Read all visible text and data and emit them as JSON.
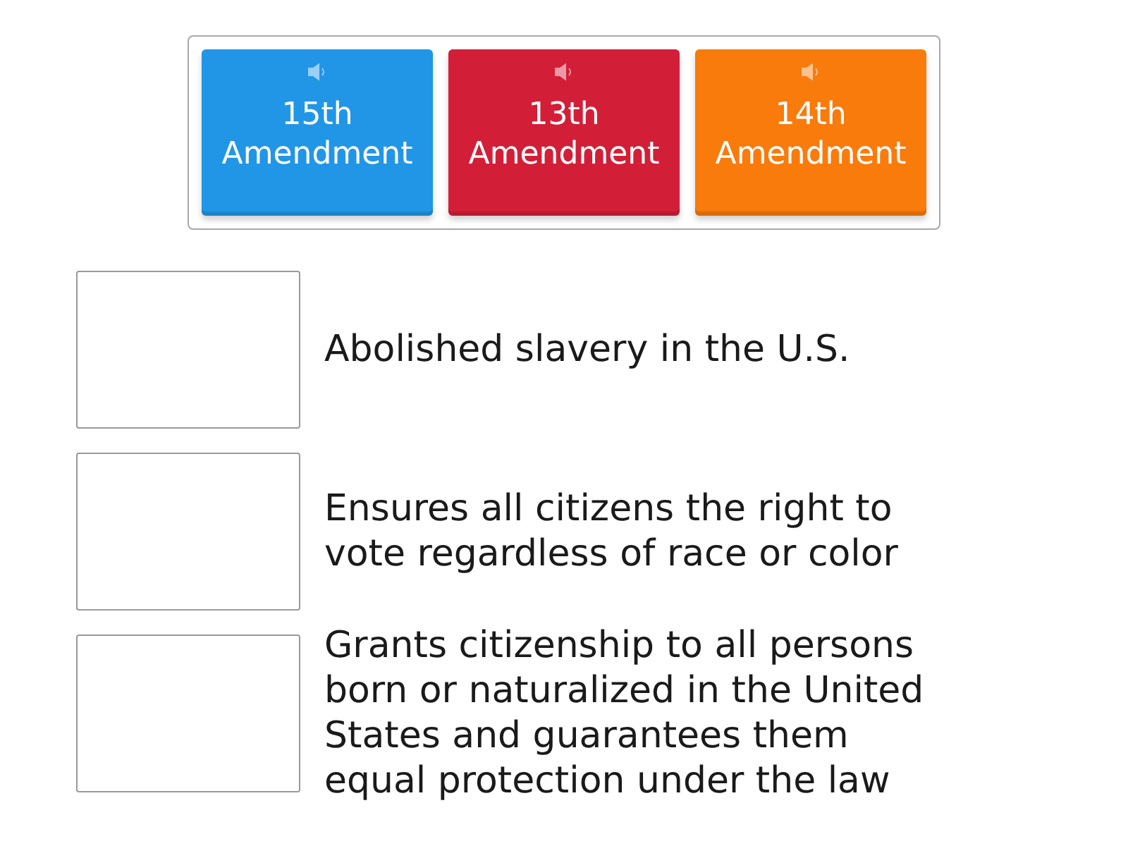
{
  "tiles": [
    {
      "label": "15th Amendment",
      "color": "#2196e6"
    },
    {
      "label": "13th Amendment",
      "color": "#d21f37"
    },
    {
      "label": "14th Amendment",
      "color": "#f97b0c"
    }
  ],
  "rows": [
    {
      "description": "Abolished slavery in the U.S."
    },
    {
      "description": "Ensures all citizens the right to vote regardless of race or color"
    },
    {
      "description": "Grants citizenship to all persons born or naturalized in the United States and guarantees them equal protection under the law"
    }
  ]
}
